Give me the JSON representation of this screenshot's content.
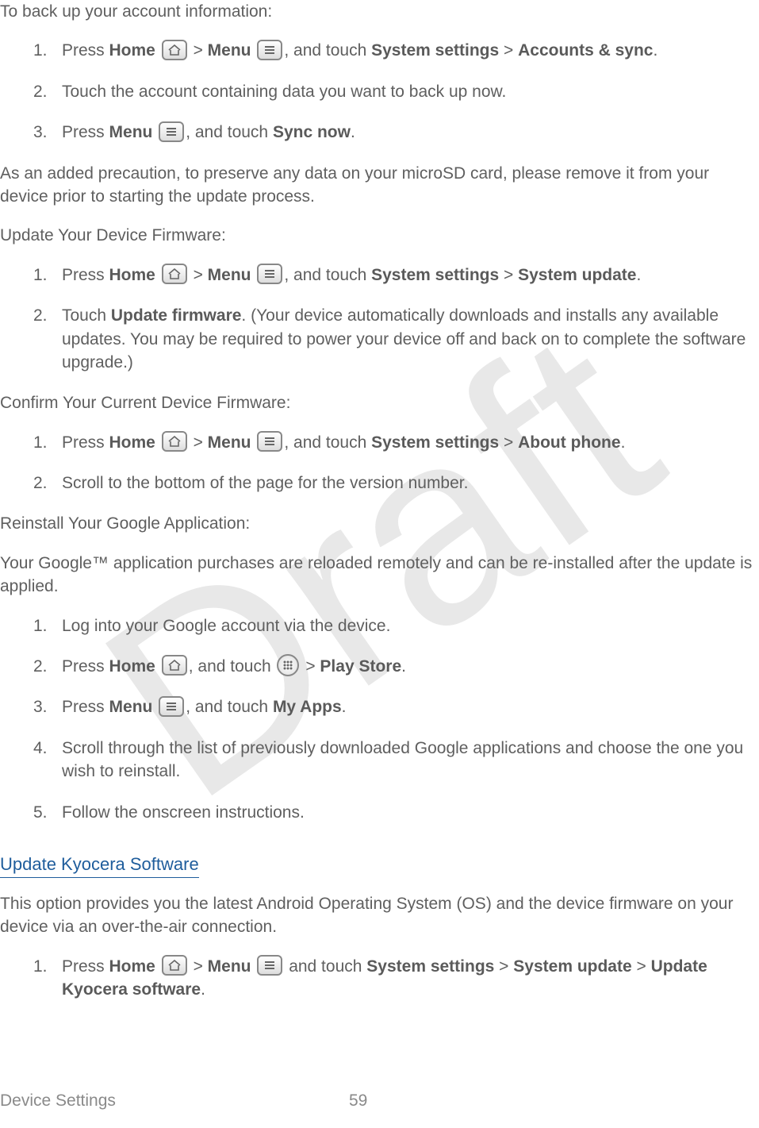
{
  "watermark": "Draft",
  "intro_backup": "To back up your account information:",
  "backup_steps": {
    "1": {
      "num": "1.",
      "press": "Press ",
      "home": "Home",
      "gt1": " > ",
      "menu": "Menu",
      "comma": ", and touch ",
      "syssettings": "System settings",
      "gt2": " > ",
      "accounts": "Accounts & sync",
      "dot": "."
    },
    "2": {
      "num": "2.",
      "text": "Touch the account containing data you want to back up now."
    },
    "3": {
      "num": "3.",
      "press": "Press ",
      "menu": "Menu",
      "comma": ", and touch ",
      "syncnow": "Sync now",
      "dot": "."
    }
  },
  "precaution": "As an added precaution, to preserve any data on your microSD card, please remove it from your device prior to starting the update process.",
  "heading_update_fw": "Update Your Device Firmware:",
  "fw_steps": {
    "1": {
      "num": "1.",
      "press": "Press ",
      "home": "Home",
      "gt1": " > ",
      "menu": "Menu",
      "comma": ", and touch ",
      "syssettings": "System settings",
      "gt2": " > ",
      "sysupdate": "System update",
      "dot": "."
    },
    "2": {
      "num": "2.",
      "touch": "Touch ",
      "updatefw": "Update firmware",
      "rest": ". (Your device automatically downloads and installs any available updates. You may be required to power your device off and back on to complete the software upgrade.)"
    }
  },
  "heading_confirm": "Confirm Your Current Device Firmware:",
  "confirm_steps": {
    "1": {
      "num": "1.",
      "press": "Press ",
      "home": "Home",
      "gt1": " > ",
      "menu": "Menu",
      "comma": ", and touch ",
      "syssettings": "System settings",
      "gt2": " > ",
      "about": "About phone",
      "dot": "."
    },
    "2": {
      "num": "2.",
      "text": "Scroll to the bottom of the page for the version number."
    }
  },
  "heading_reinstall": "Reinstall Your Google Application:",
  "reinstall_intro": "Your Google™ application purchases are reloaded remotely and can be re-installed after the update is applied.",
  "reinstall_steps": {
    "1": {
      "num": "1.",
      "text": "Log into your Google account via the device."
    },
    "2": {
      "num": "2.",
      "press": "Press ",
      "home": "Home",
      "comma1": ", and touch ",
      "gt": " > ",
      "playstore": "Play Store",
      "dot": "."
    },
    "3": {
      "num": "3.",
      "press": "Press ",
      "menu": "Menu",
      "comma": ", and touch ",
      "myapps": "My Apps",
      "dot": "."
    },
    "4": {
      "num": "4.",
      "text": "Scroll through the list of previously downloaded Google applications and choose the one you wish to reinstall."
    },
    "5": {
      "num": "5.",
      "text": "Follow the onscreen instructions."
    }
  },
  "heading_kyocera": "Update Kyocera Software",
  "kyocera_intro": "This option provides you the latest Android Operating System (OS) and the device firmware on your device via an over-the-air connection.",
  "kyocera_steps": {
    "1": {
      "num": "1.",
      "press": "Press ",
      "home": "Home",
      "gt1": " > ",
      "menu": "Menu",
      "and": " and touch ",
      "syssettings": "System settings",
      "gt2": " > ",
      "sysupdate": "System update",
      "gt3": " > ",
      "updateky": "Update Kyocera software",
      "dot": "."
    }
  },
  "footer_left": "Device Settings",
  "footer_page": "59"
}
